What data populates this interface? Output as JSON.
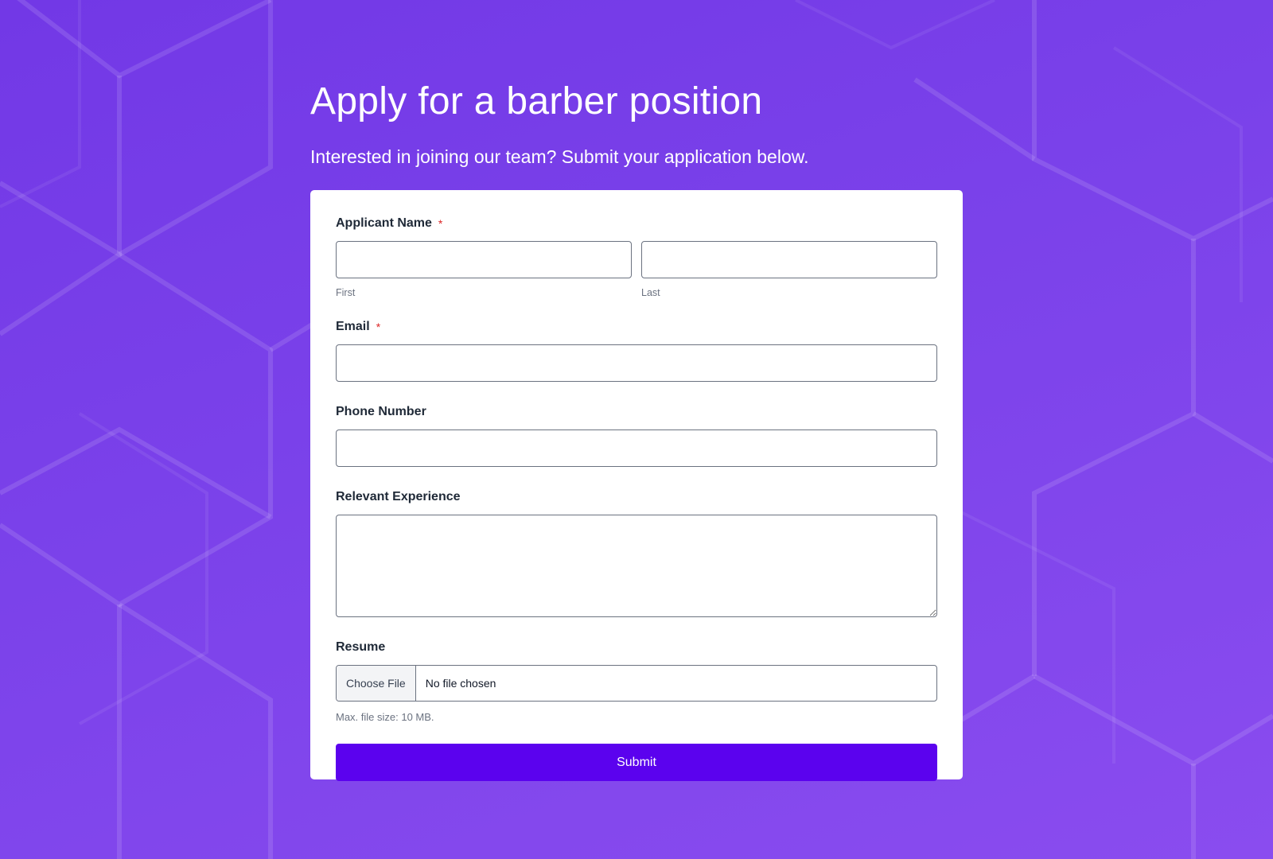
{
  "header": {
    "title": "Apply for a barber position",
    "subtitle": "Interested in joining our team? Submit your application below."
  },
  "form": {
    "applicant_name": {
      "label": "Applicant Name",
      "required_mark": "*",
      "first_sublabel": "First",
      "last_sublabel": "Last",
      "first_value": "",
      "last_value": ""
    },
    "email": {
      "label": "Email",
      "required_mark": "*",
      "value": ""
    },
    "phone": {
      "label": "Phone Number",
      "value": ""
    },
    "experience": {
      "label": "Relevant Experience",
      "value": ""
    },
    "resume": {
      "label": "Resume",
      "button_label": "Choose File",
      "status": "No file chosen",
      "hint": "Max. file size: 10 MB."
    },
    "submit_label": "Submit"
  },
  "colors": {
    "background": "#7b42ea",
    "card": "#ffffff",
    "accent": "#5b02ee",
    "required": "#dc2626"
  }
}
